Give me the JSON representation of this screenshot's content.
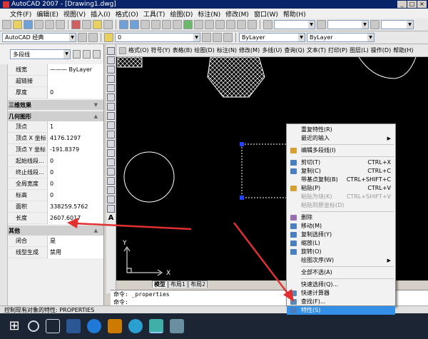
{
  "app": {
    "title": "AutoCAD 2007 - [Drawing1.dwg]",
    "window_buttons": [
      "_",
      "□",
      "×"
    ]
  },
  "menu": [
    "文件(F)",
    "编辑(E)",
    "视图(V)",
    "插入(I)",
    "格式(O)",
    "工具(T)",
    "绘图(D)",
    "标注(N)",
    "修改(M)",
    "窗口(W)",
    "帮助(H)"
  ],
  "toolbar": {
    "workspace": "AutoCAD 经典",
    "layer": "0",
    "color": "ByLayer",
    "linetype": "ByLayer"
  },
  "dim_toolbar": [
    "格式(O)",
    "符号(Y)",
    "表格(B)",
    "绘图(D)",
    "标注(N)",
    "修改(M)",
    "多线(U)",
    "查询(Q)",
    "文本(T)",
    "打印(P)",
    "图层(L)",
    "操作(D)",
    "帮助(H)"
  ],
  "properties": {
    "object_type": "多段线",
    "general": [
      {
        "key": "线宽",
        "value": "——— ByLayer"
      },
      {
        "key": "超链接",
        "value": ""
      },
      {
        "key": "厚度",
        "value": "0"
      }
    ],
    "section_3d": "三维效果",
    "section_geometry": "几何图形",
    "geometry": [
      {
        "key": "顶点",
        "value": "1"
      },
      {
        "key": "顶点 X 坐标",
        "value": "4176.1297"
      },
      {
        "key": "顶点 Y 坐标",
        "value": "-191.8379"
      },
      {
        "key": "起始线段...",
        "value": "0"
      },
      {
        "key": "终止线段...",
        "value": "0"
      },
      {
        "key": "全局宽度",
        "value": "0"
      },
      {
        "key": "标高",
        "value": "0"
      },
      {
        "key": "面积",
        "value": "338259.5762"
      },
      {
        "key": "长度",
        "value": "2607.6017"
      }
    ],
    "section_misc": "其他",
    "misc": [
      {
        "key": "闭合",
        "value": "是"
      },
      {
        "key": "线型生成",
        "value": "禁用"
      }
    ]
  },
  "tabs": [
    "模型",
    "布局1",
    "布局2"
  ],
  "command": {
    "line1": "命令: _properties",
    "line2": "命令:"
  },
  "status": "控制现有对象的特性:  PROPERTIES",
  "context_menu": {
    "items": [
      {
        "label": "重复特性(R)",
        "shortcut": "",
        "type": "item"
      },
      {
        "label": "最近的输入",
        "shortcut": "",
        "type": "submenu"
      },
      {
        "type": "sep"
      },
      {
        "label": "编辑多段线(I)",
        "shortcut": "",
        "type": "item",
        "icon": "#d4a030"
      },
      {
        "type": "sep"
      },
      {
        "label": "剪切(T)",
        "shortcut": "CTRL+X",
        "type": "item",
        "icon": "#4a7fc0"
      },
      {
        "label": "复制(C)",
        "shortcut": "CTRL+C",
        "type": "item",
        "icon": "#4a7fc0"
      },
      {
        "label": "带基点复制(B)",
        "shortcut": "CTRL+SHIFT+C",
        "type": "item"
      },
      {
        "label": "粘贴(P)",
        "shortcut": "CTRL+V",
        "type": "item",
        "icon": "#d4a030"
      },
      {
        "label": "粘贴为块(K)",
        "shortcut": "CTRL+SHIFT+V",
        "type": "disabled"
      },
      {
        "label": "粘贴到原坐标(D)",
        "shortcut": "",
        "type": "disabled"
      },
      {
        "type": "sep"
      },
      {
        "label": "删除",
        "shortcut": "",
        "type": "item",
        "icon": "#9a6fb0"
      },
      {
        "label": "移动(M)",
        "shortcut": "",
        "type": "item",
        "icon": "#4a7fc0"
      },
      {
        "label": "复制选择(Y)",
        "shortcut": "",
        "type": "item",
        "icon": "#4a7fc0"
      },
      {
        "label": "缩放(L)",
        "shortcut": "",
        "type": "item",
        "icon": "#4a7fc0"
      },
      {
        "label": "旋转(O)",
        "shortcut": "",
        "type": "item",
        "icon": "#4a7fc0"
      },
      {
        "label": "绘图次序(W)",
        "shortcut": "",
        "type": "submenu"
      },
      {
        "type": "sep"
      },
      {
        "label": "全部不选(A)",
        "shortcut": "",
        "type": "item"
      },
      {
        "type": "sep"
      },
      {
        "label": "快速选择(Q)...",
        "shortcut": "",
        "type": "item"
      },
      {
        "label": "快速计算器",
        "shortcut": "",
        "type": "item",
        "icon": "#5a8ab0"
      },
      {
        "label": "查找(F)...",
        "shortcut": "",
        "type": "item",
        "icon": "#5a8ab0"
      },
      {
        "label": "特性(S)",
        "shortcut": "",
        "type": "highlight",
        "icon": "#4a7fc0"
      }
    ]
  },
  "colors": {
    "canvas": "#000000",
    "grip": "#2244ff",
    "highlight": "#3390e6",
    "arrow": "#e03030"
  }
}
